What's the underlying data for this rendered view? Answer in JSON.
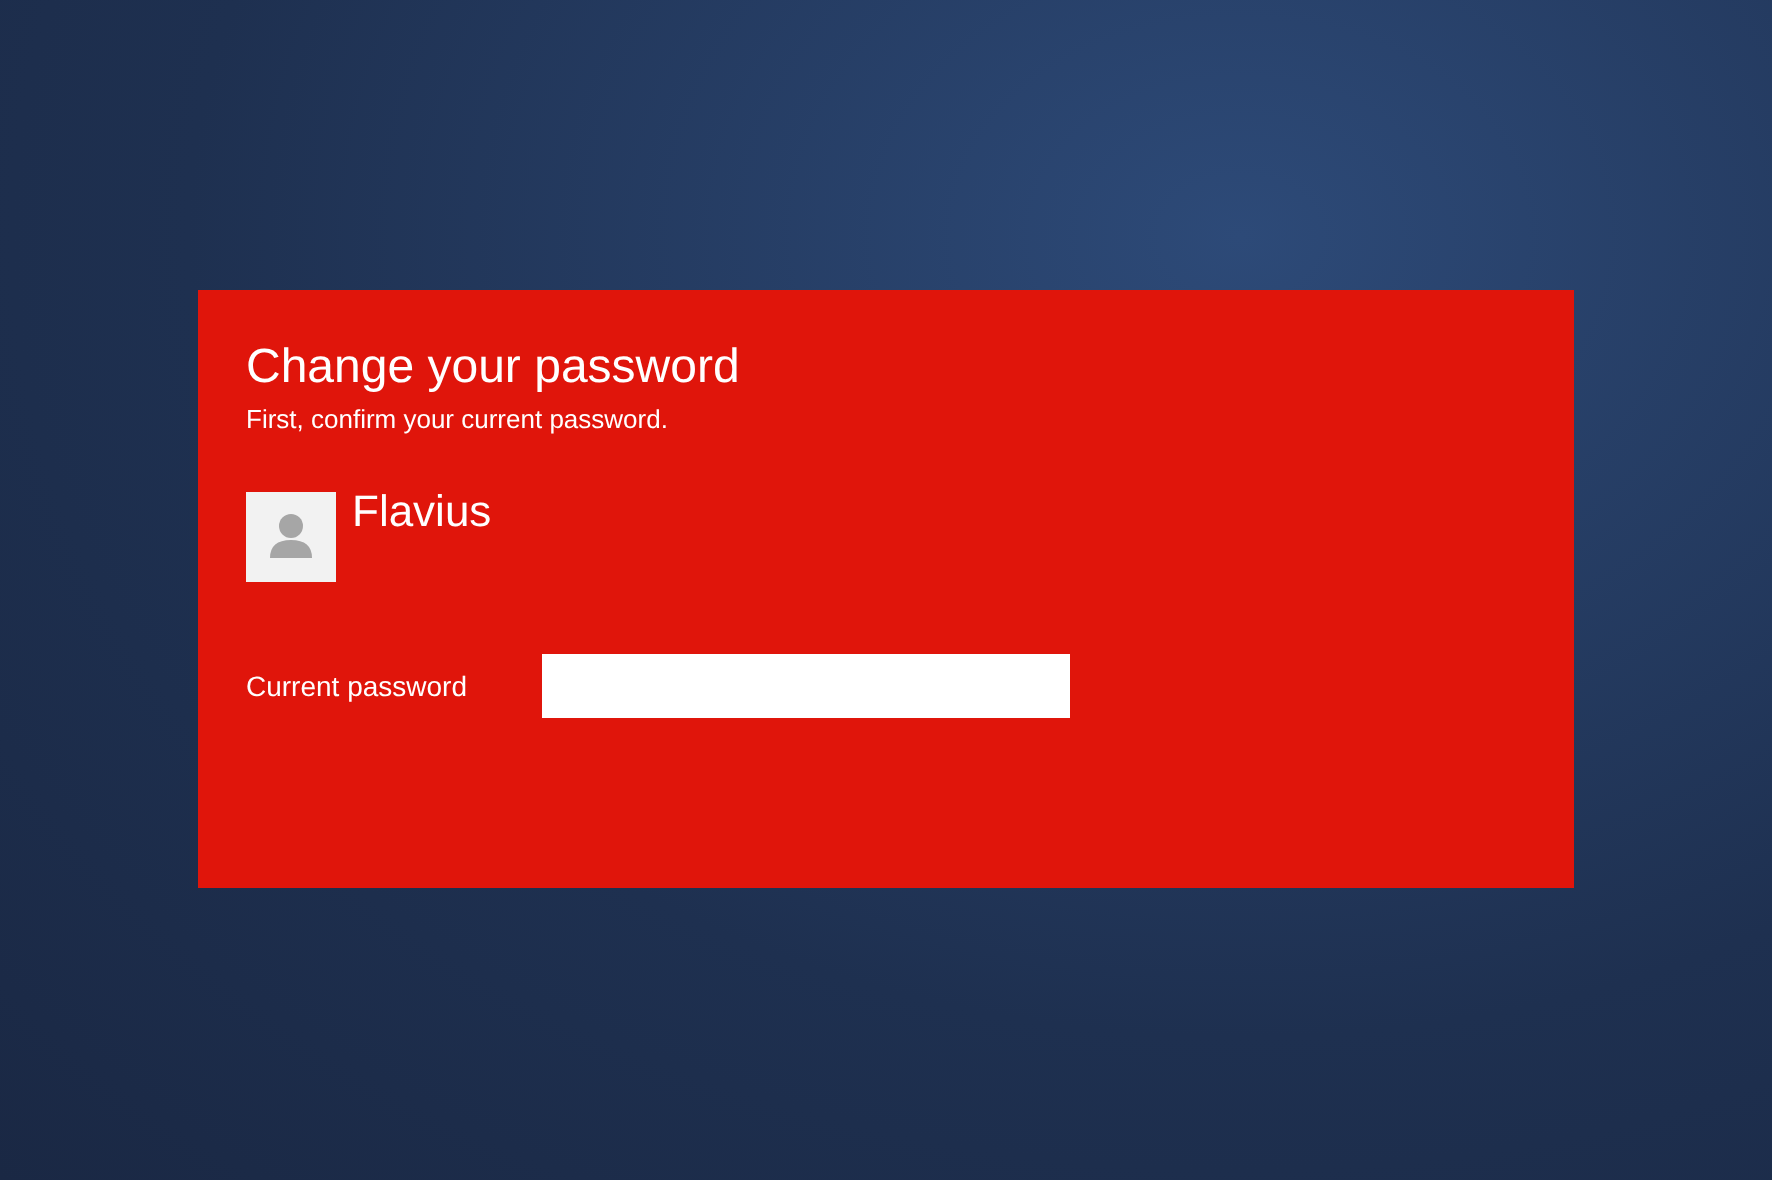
{
  "dialog": {
    "title": "Change your password",
    "subtitle": "First, confirm your current password.",
    "user": {
      "name": "Flavius"
    },
    "field": {
      "label": "Current password"
    }
  }
}
